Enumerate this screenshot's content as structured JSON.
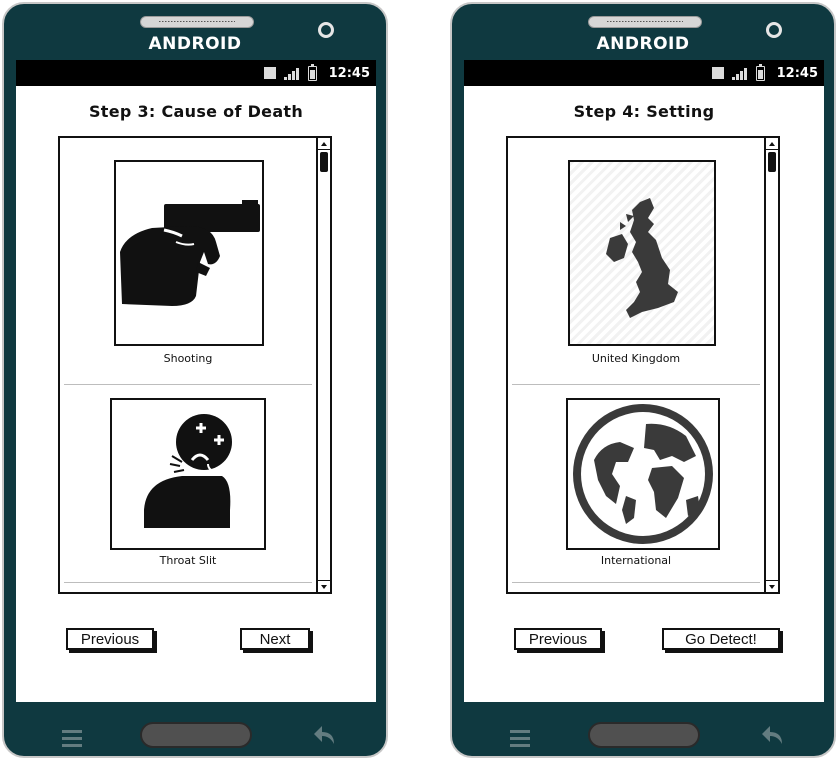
{
  "status_bar": {
    "time": "12:45"
  },
  "phones": [
    {
      "brand": "ANDROID",
      "title": "Step 3: Cause of Death",
      "items": [
        {
          "label": "Shooting",
          "icon": "handgun-icon"
        },
        {
          "label": "Throat Slit",
          "icon": "throat-slit-icon"
        }
      ],
      "buttons": {
        "previous": "Previous",
        "next": "Next"
      }
    },
    {
      "brand": "ANDROID",
      "title": "Step 4: Setting",
      "items": [
        {
          "label": "United Kingdom",
          "icon": "uk-map-icon"
        },
        {
          "label": "International",
          "icon": "globe-icon"
        }
      ],
      "buttons": {
        "previous": "Previous",
        "next": "Go Detect!"
      }
    }
  ],
  "colors": {
    "phone_body": "#0f3940",
    "screen": "#ffffff",
    "ink": "#111111"
  }
}
